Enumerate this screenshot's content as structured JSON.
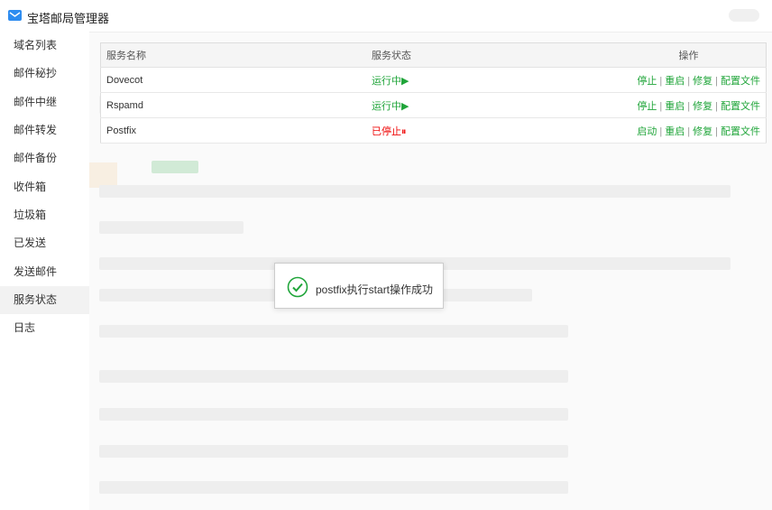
{
  "window": {
    "title": "宝塔邮局管理器"
  },
  "sidebar": {
    "items": [
      {
        "label": "域名列表"
      },
      {
        "label": "邮件秘抄"
      },
      {
        "label": "邮件中继"
      },
      {
        "label": "邮件转发"
      },
      {
        "label": "邮件备份"
      },
      {
        "label": "收件箱"
      },
      {
        "label": "垃圾箱"
      },
      {
        "label": "已发送"
      },
      {
        "label": "发送邮件"
      },
      {
        "label": "服务状态"
      },
      {
        "label": "日志"
      }
    ],
    "active_index": 9
  },
  "services": {
    "headers": {
      "name": "服务名称",
      "status": "服务状态",
      "actions": "操作"
    },
    "rows": [
      {
        "name": "Dovecot",
        "status": "运行中",
        "status_icon": "▶",
        "running": true,
        "actions": [
          "停止",
          "重启",
          "修复",
          "配置文件"
        ]
      },
      {
        "name": "Rspamd",
        "status": "运行中",
        "status_icon": "▶",
        "running": true,
        "actions": [
          "停止",
          "重启",
          "修复",
          "配置文件"
        ]
      },
      {
        "name": "Postfix",
        "status": "已停止",
        "status_icon": "⏸",
        "running": false,
        "actions": [
          "启动",
          "重启",
          "修复",
          "配置文件"
        ]
      }
    ]
  },
  "toast": {
    "message": "postfix执行start操作成功",
    "icon": "check-circle-icon"
  },
  "colors": {
    "accent_green": "#20a53a",
    "stopped_red": "#ef0808",
    "app_icon_blue": "#2d8cf0"
  }
}
